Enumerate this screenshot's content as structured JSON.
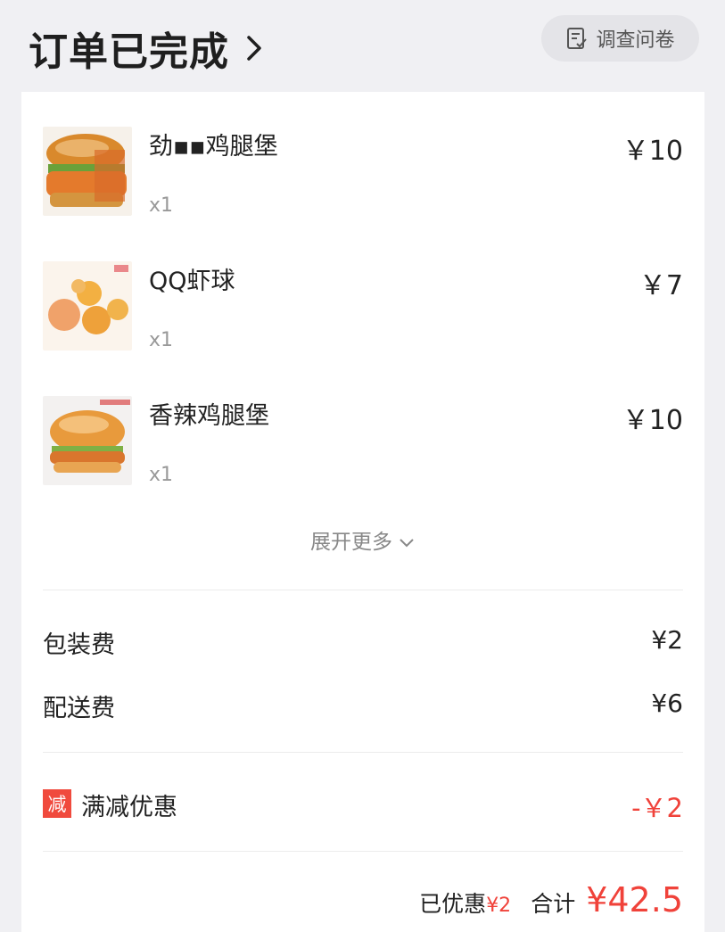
{
  "header": {
    "title": "订单已完成",
    "survey_label": "调查问卷"
  },
  "items": [
    {
      "name": "劲▪▪鸡腿堡",
      "qty": "x1",
      "price": "￥10"
    },
    {
      "name": "QQ虾球",
      "qty": "x1",
      "price": "￥7"
    },
    {
      "name": "香辣鸡腿堡",
      "qty": "x1",
      "price": "￥10"
    }
  ],
  "expand_label": "展开更多",
  "fees": {
    "packing_label": "包装费",
    "packing_value": "¥2",
    "delivery_label": "配送费",
    "delivery_value": "¥6"
  },
  "promo": {
    "badge": "减",
    "label": "满减优惠",
    "value": "-￥2"
  },
  "totals": {
    "saved_label": "已优惠",
    "saved_value": "¥2",
    "total_label": "合计",
    "total_value": "¥42.5"
  },
  "colors": {
    "accent_red": "#f0423a",
    "background": "#f0f0f3"
  }
}
